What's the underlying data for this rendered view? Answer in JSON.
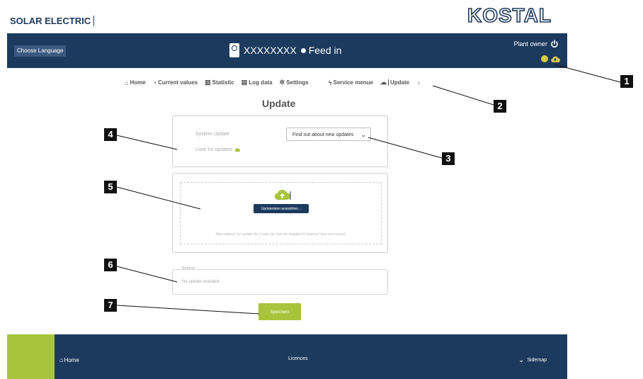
{
  "brand": {
    "left": "SOLAR ELECTRIC",
    "right": "KOSTAL"
  },
  "topbar": {
    "language_button": "Choose Language",
    "device_name": "XXXXXXXX",
    "feed_status": "Feed in",
    "owner_label": "Plant owner"
  },
  "nav": {
    "items": [
      {
        "label": "Home",
        "icon": "home-icon"
      },
      {
        "label": "Current values",
        "icon": "gauge-icon"
      },
      {
        "label": "Statistic",
        "icon": "bar-chart-icon"
      },
      {
        "label": "Log data",
        "icon": "document-icon"
      },
      {
        "label": "Settings",
        "icon": "gear-icon"
      },
      {
        "label": "Service menue",
        "icon": "lightning-icon"
      },
      {
        "label": "Update",
        "icon": "cloud-upload-icon"
      }
    ]
  },
  "page_title": "Update",
  "system_update": {
    "label": "System Update",
    "selected_option": "Find out about new updates",
    "look_for_updates": "Look for updates"
  },
  "upload": {
    "button_label": "Updatedatei auswählen...",
    "hint": "Alternatively, an update file (.swu) can also be dragged & dropped here and stored."
  },
  "status": {
    "legend": "Status",
    "text": "No update available"
  },
  "save_button": "Speichern",
  "footer": {
    "home": "Home",
    "licences": "Licences",
    "sitemap": "Sidemap"
  },
  "callouts": [
    "1",
    "2",
    "3",
    "4",
    "5",
    "6",
    "7"
  ],
  "colors": {
    "navy": "#1c3a5e",
    "accent_green": "#a8c43c",
    "status_yellow": "#d6c84c"
  }
}
